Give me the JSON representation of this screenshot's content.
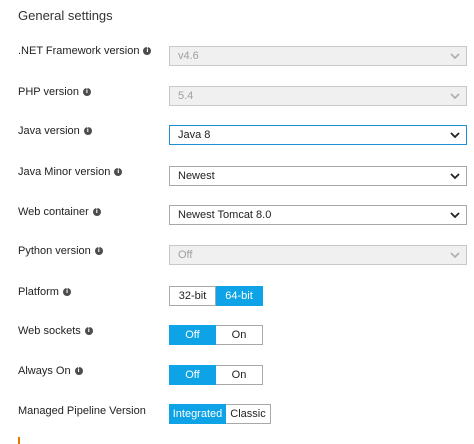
{
  "section_title": "General settings",
  "rows": {
    "dotnet": {
      "label": ".NET Framework version",
      "value": "v4.6"
    },
    "php": {
      "label": "PHP version",
      "value": "5.4"
    },
    "java": {
      "label": "Java version",
      "value": "Java 8"
    },
    "java_minor": {
      "label": "Java Minor version",
      "value": "Newest"
    },
    "web_container": {
      "label": "Web container",
      "value": "Newest Tomcat 8.0"
    },
    "python": {
      "label": "Python version",
      "value": "Off"
    },
    "platform": {
      "label": "Platform",
      "options": [
        "32-bit",
        "64-bit"
      ],
      "selected": "64-bit"
    },
    "web_sockets": {
      "label": "Web sockets",
      "options": [
        "Off",
        "On"
      ],
      "selected": "Off"
    },
    "always_on": {
      "label": "Always On",
      "options": [
        "Off",
        "On"
      ],
      "selected": "Off"
    },
    "pipeline": {
      "label": "Managed Pipeline Version",
      "options": [
        "Integrated",
        "Classic"
      ],
      "selected": "Integrated"
    }
  },
  "info_icon_glyph": "i",
  "colors": {
    "accent": "#0ea2e6",
    "focus_border": "#1e8fd6"
  }
}
